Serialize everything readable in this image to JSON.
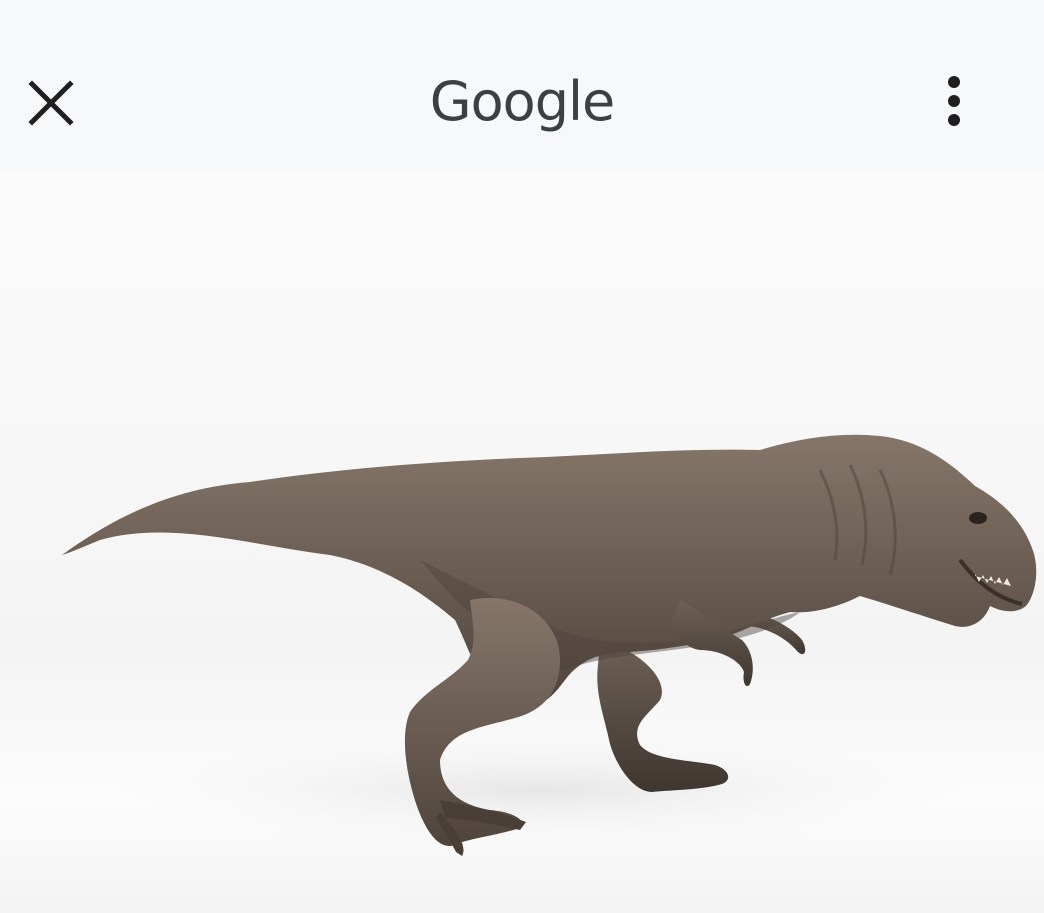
{
  "header": {
    "title": "Google"
  },
  "icons": {
    "close": "close-icon",
    "menu": "more-vert-icon",
    "model": "dinosaur-3d-model"
  },
  "colors": {
    "title": "#3c4043",
    "icon": "#1f1f1f",
    "header_bg": "#f7f8f9",
    "model_skin": "#6b5d52"
  }
}
